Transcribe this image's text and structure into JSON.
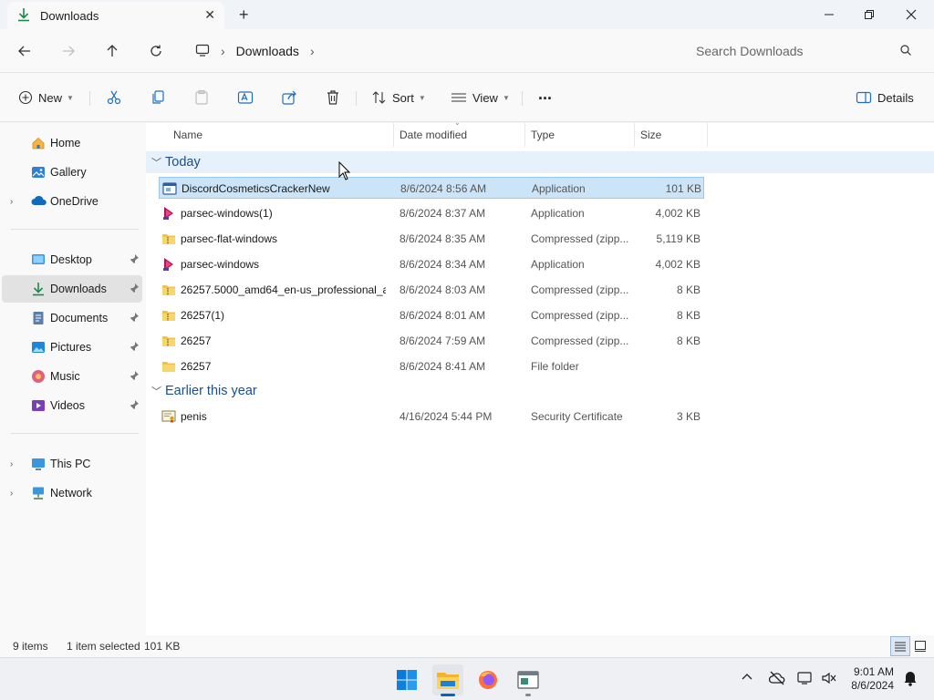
{
  "window": {
    "tab_title": "Downloads",
    "controls": {
      "minimize": "minimize",
      "maximize": "maximize",
      "close": "close"
    }
  },
  "address": {
    "breadcrumb": [
      "Downloads"
    ],
    "search_placeholder": "Search Downloads"
  },
  "commandbar": {
    "new_label": "New",
    "sort_label": "Sort",
    "view_label": "View",
    "more_label": "...",
    "details_label": "Details"
  },
  "nav": {
    "items": [
      {
        "label": "Home",
        "icon": "home-icon"
      },
      {
        "label": "Gallery",
        "icon": "gallery-icon"
      },
      {
        "label": "OneDrive",
        "icon": "onedrive-icon"
      },
      {
        "label": "Desktop",
        "icon": "desktop-icon"
      },
      {
        "label": "Downloads",
        "icon": "downloads-icon"
      },
      {
        "label": "Documents",
        "icon": "documents-icon"
      },
      {
        "label": "Pictures",
        "icon": "pictures-icon"
      },
      {
        "label": "Music",
        "icon": "music-icon"
      },
      {
        "label": "Videos",
        "icon": "videos-icon"
      },
      {
        "label": "This PC",
        "icon": "this-pc-icon"
      },
      {
        "label": "Network",
        "icon": "network-icon"
      }
    ]
  },
  "columns": {
    "name": "Name",
    "date": "Date modified",
    "type": "Type",
    "size": "Size"
  },
  "groups": [
    {
      "label": "Today",
      "files": [
        {
          "name": "DiscordCosmeticsCrackerNew",
          "date": "8/6/2024 8:56 AM",
          "type": "Application",
          "size": "101 KB",
          "icon": "application-icon",
          "selected": true
        },
        {
          "name": "parsec-windows(1)",
          "date": "8/6/2024 8:37 AM",
          "type": "Application",
          "size": "4,002 KB",
          "icon": "parsec-icon"
        },
        {
          "name": "parsec-flat-windows",
          "date": "8/6/2024 8:35 AM",
          "type": "Compressed (zipp...",
          "size": "5,119 KB",
          "icon": "zip-folder-icon"
        },
        {
          "name": "parsec-windows",
          "date": "8/6/2024 8:34 AM",
          "type": "Application",
          "size": "4,002 KB",
          "icon": "parsec-icon"
        },
        {
          "name": "26257.5000_amd64_en-us_professional_a...",
          "date": "8/6/2024 8:03 AM",
          "type": "Compressed (zipp...",
          "size": "8 KB",
          "icon": "zip-folder-icon"
        },
        {
          "name": "26257(1)",
          "date": "8/6/2024 8:01 AM",
          "type": "Compressed (zipp...",
          "size": "8 KB",
          "icon": "zip-folder-icon"
        },
        {
          "name": "26257",
          "date": "8/6/2024 7:59 AM",
          "type": "Compressed (zipp...",
          "size": "8 KB",
          "icon": "zip-folder-icon"
        },
        {
          "name": "26257",
          "date": "8/6/2024 8:41 AM",
          "type": "File folder",
          "size": "",
          "icon": "folder-icon"
        }
      ]
    },
    {
      "label": "Earlier this year",
      "files": [
        {
          "name": "penis",
          "date": "4/16/2024 5:44 PM",
          "type": "Security Certificate",
          "size": "3 KB",
          "icon": "certificate-icon"
        }
      ]
    }
  ],
  "status": {
    "count": "9 items",
    "selection": "1 item selected",
    "selection_size": "101 KB"
  },
  "taskbar": {
    "time": "9:01 AM",
    "date": "8/6/2024"
  },
  "colors": {
    "accent": "#0067c0",
    "selection": "#cce4f7",
    "group_text": "#1c4f85"
  }
}
